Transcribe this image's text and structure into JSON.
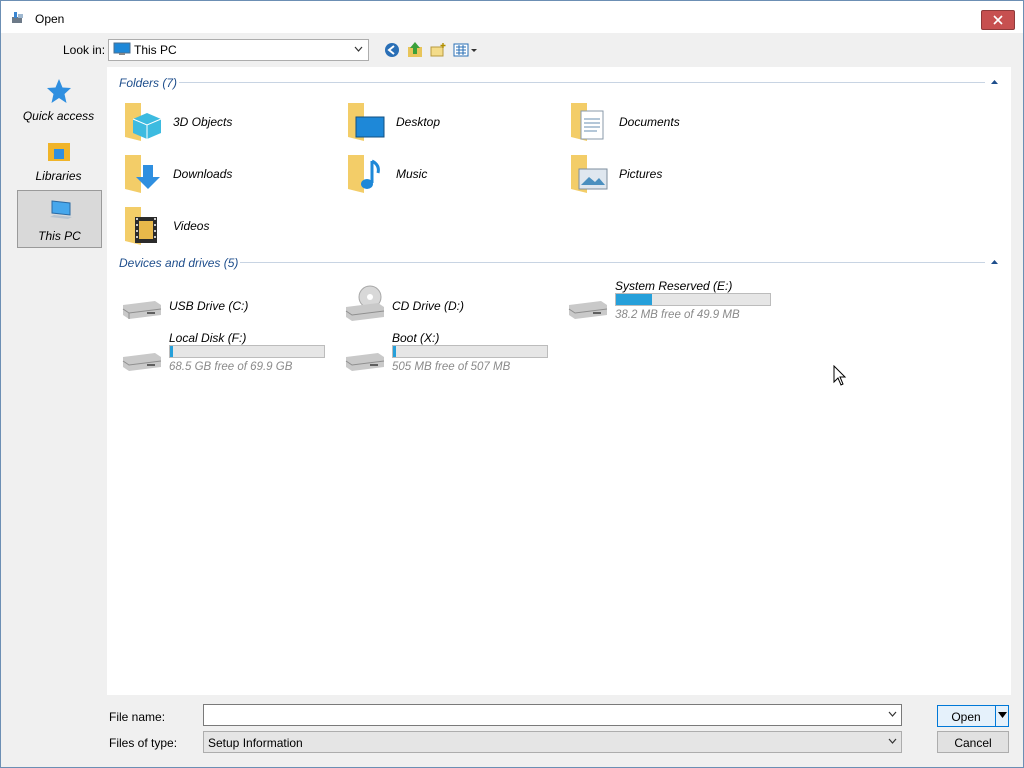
{
  "window": {
    "title": "Open"
  },
  "toolbar": {
    "look_in_label": "Look in:",
    "look_in_value": "This PC"
  },
  "places": [
    {
      "label": "Quick access",
      "icon": "star-icon"
    },
    {
      "label": "Libraries",
      "icon": "libraries-icon"
    },
    {
      "label": "This PC",
      "icon": "computer-icon",
      "selected": true
    }
  ],
  "folders": {
    "header": "Folders (7)",
    "items": [
      {
        "label": "3D Objects",
        "icon": "3d-objects-folder-icon"
      },
      {
        "label": "Desktop",
        "icon": "desktop-folder-icon"
      },
      {
        "label": "Documents",
        "icon": "documents-folder-icon"
      },
      {
        "label": "Downloads",
        "icon": "downloads-folder-icon"
      },
      {
        "label": "Music",
        "icon": "music-folder-icon"
      },
      {
        "label": "Pictures",
        "icon": "pictures-folder-icon"
      },
      {
        "label": "Videos",
        "icon": "videos-folder-icon"
      }
    ]
  },
  "devices": {
    "header": "Devices and drives (5)",
    "items": [
      {
        "label": "USB Drive (C:)",
        "icon": "drive-icon"
      },
      {
        "label": "CD Drive (D:)",
        "icon": "cd-drive-icon"
      },
      {
        "label": "System Reserved (E:)",
        "icon": "drive-icon",
        "free": "38.2 MB free of 49.9 MB",
        "used_fraction": 0.234
      },
      {
        "label": "Local Disk (F:)",
        "icon": "drive-icon",
        "free": "68.5 GB free of 69.9 GB",
        "used_fraction": 0.02
      },
      {
        "label": "Boot (X:)",
        "icon": "drive-icon",
        "free": "505 MB free of 507 MB",
        "used_fraction": 0.004
      }
    ]
  },
  "footer": {
    "file_name_label": "File name:",
    "file_name_value": "",
    "files_of_type_label": "Files of type:",
    "files_of_type_value": "Setup Information",
    "open_label": "Open",
    "cancel_label": "Cancel"
  },
  "colors": {
    "accent": "#0078d7",
    "bar_fill": "#26a0da",
    "close": "#c75050",
    "header_text": "#1e4e8c"
  }
}
